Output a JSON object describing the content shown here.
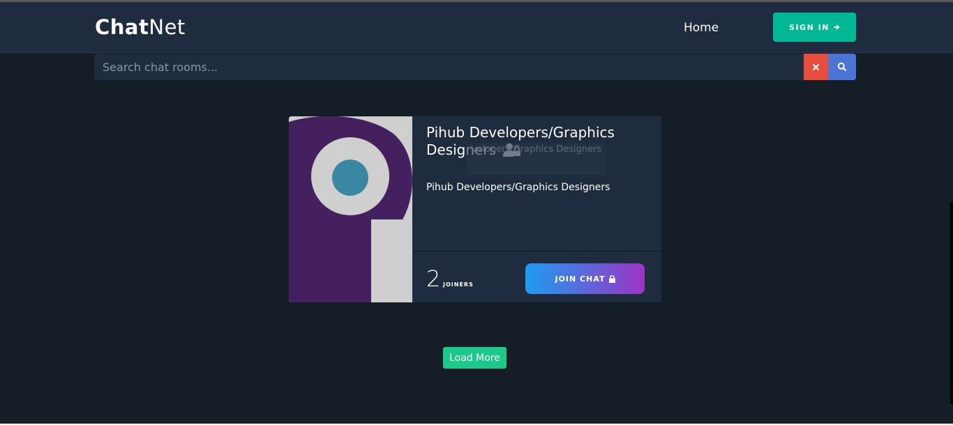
{
  "brand": {
    "bold": "Chat",
    "light": "Net"
  },
  "nav": {
    "home": "Home",
    "signin": "SIGN IN"
  },
  "search": {
    "placeholder": "Search chat rooms...",
    "value": ""
  },
  "room": {
    "title": "Pihub Developers/Graphics Designers",
    "tooltip": "Pihub Developers/Graphics Designers",
    "tooltip_visible": "velopers/Graphics Designers",
    "description": "Pihub Developers/Graphics Designers",
    "joiners_count": "2",
    "joiners_label": "JOINERS",
    "join_label": "JOIN CHAT"
  },
  "load_more": "Load More",
  "colors": {
    "background": "#151e27",
    "navbar": "#1f2b3f",
    "signin": "#00b894",
    "clear": "#e74c3c",
    "search_button": "#4a74d6",
    "load_more": "#1cc88a",
    "logo_purple": "#44205e",
    "logo_teal": "#3a87a4"
  },
  "icons": [
    "arrow-right-icon",
    "close-icon",
    "search-icon",
    "user-lock-icon",
    "lock-icon"
  ]
}
